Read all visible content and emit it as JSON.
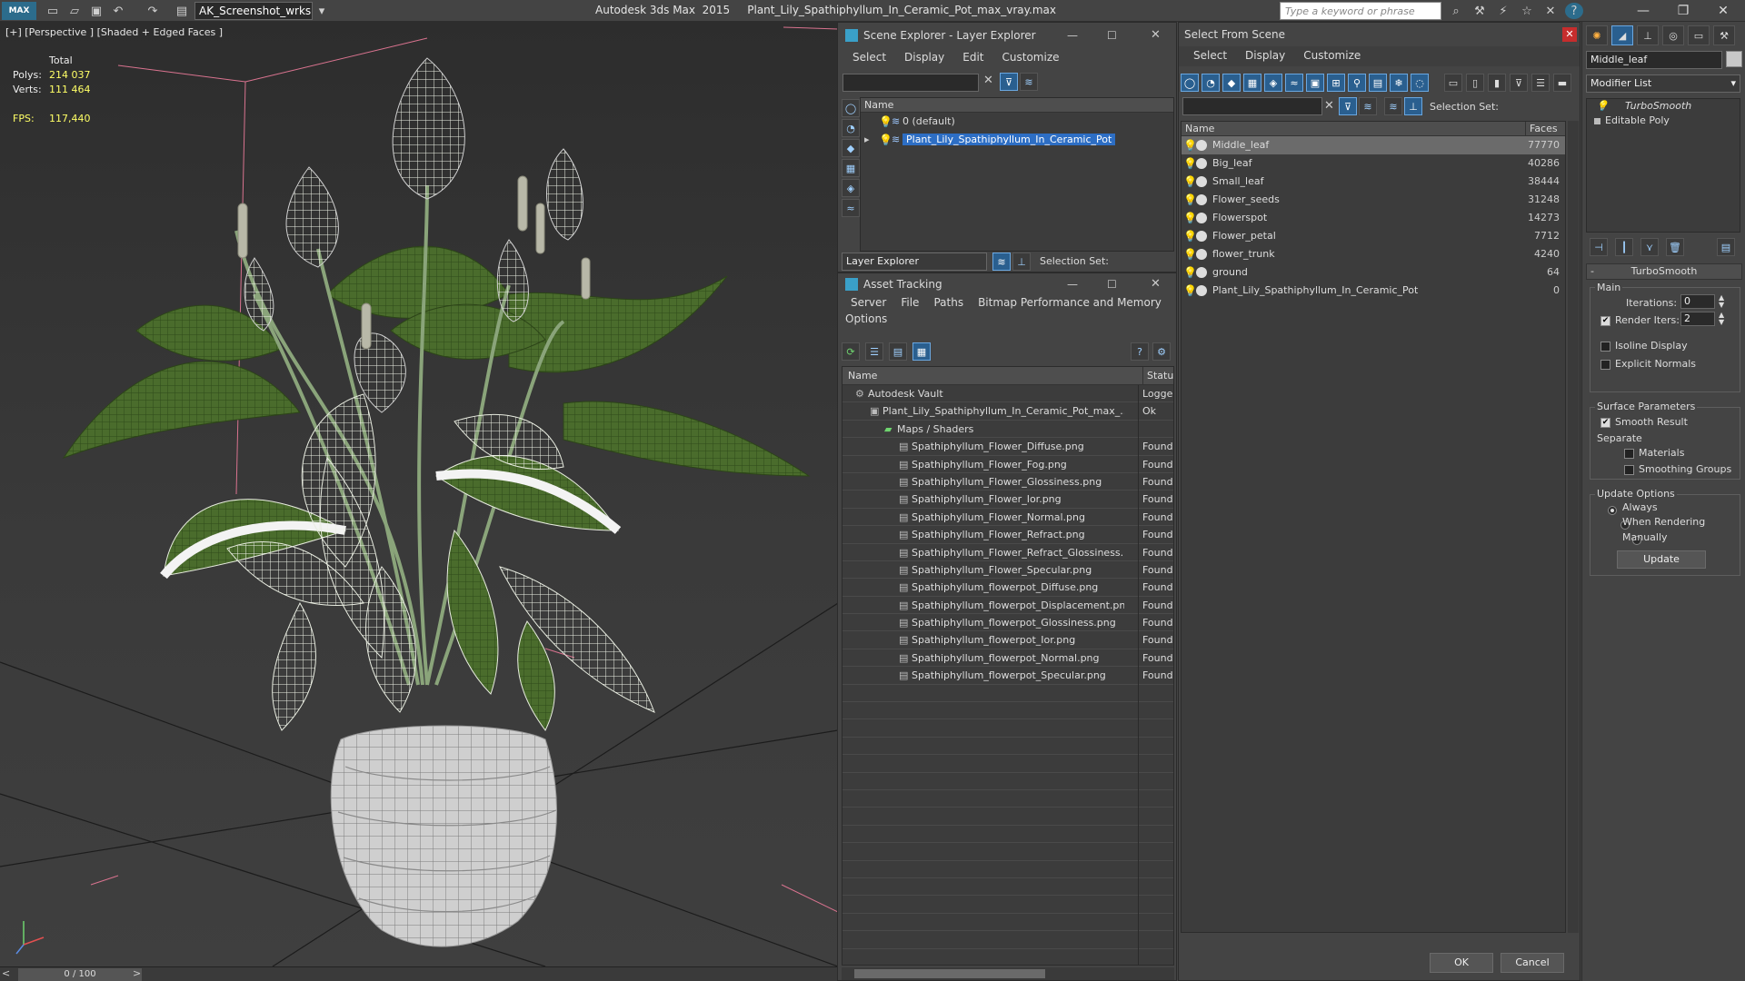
{
  "app": {
    "logo": "MAX",
    "workspace": "AK_Screenshot_wrksp",
    "title": "Autodesk 3ds Max  2015     Plant_Lily_Spathiphyllum_In_Ceramic_Pot_max_vray.max",
    "search_placeholder": "Type a keyword or phrase"
  },
  "viewport": {
    "label": "[+] [Perspective ] [Shaded + Edged Faces ]",
    "stats": {
      "total_label": "Total",
      "polys_label": "Polys:",
      "polys": "214 037",
      "verts_label": "Verts:",
      "verts": "111 464",
      "fps_label": "FPS:",
      "fps": "117,440"
    },
    "frame": "0 / 100"
  },
  "scene_explorer": {
    "title": "Scene Explorer - Layer Explorer",
    "menu": [
      "Select",
      "Display",
      "Edit",
      "Customize"
    ],
    "column": "Name",
    "rows": [
      "0 (default)",
      "Plant_Lily_Spathiphyllum_In_Ceramic_Pot"
    ],
    "footer_dropdown": "Layer Explorer",
    "selection_set": "Selection Set:"
  },
  "asset_tracking": {
    "title": "Asset Tracking",
    "menu": [
      "Server",
      "File",
      "Paths",
      "Bitmap Performance and Memory",
      "Options"
    ],
    "columns": [
      "Name",
      "Status"
    ],
    "rows": [
      {
        "name": "Autodesk Vault",
        "status": "Logge",
        "indent": 0
      },
      {
        "name": "Plant_Lily_Spathiphyllum_In_Ceramic_Pot_max_...",
        "status": "Ok",
        "indent": 1
      },
      {
        "name": "Maps / Shaders",
        "status": "",
        "indent": 2
      },
      {
        "name": "Spathiphyllum_Flower_Diffuse.png",
        "status": "Found",
        "indent": 3
      },
      {
        "name": "Spathiphyllum_Flower_Fog.png",
        "status": "Found",
        "indent": 3
      },
      {
        "name": "Spathiphyllum_Flower_Glossiness.png",
        "status": "Found",
        "indent": 3
      },
      {
        "name": "Spathiphyllum_Flower_Ior.png",
        "status": "Found",
        "indent": 3
      },
      {
        "name": "Spathiphyllum_Flower_Normal.png",
        "status": "Found",
        "indent": 3
      },
      {
        "name": "Spathiphyllum_Flower_Refract.png",
        "status": "Found",
        "indent": 3
      },
      {
        "name": "Spathiphyllum_Flower_Refract_Glossiness....",
        "status": "Found",
        "indent": 3
      },
      {
        "name": "Spathiphyllum_Flower_Specular.png",
        "status": "Found",
        "indent": 3
      },
      {
        "name": "Spathiphyllum_flowerpot_Diffuse.png",
        "status": "Found",
        "indent": 3
      },
      {
        "name": "Spathiphyllum_flowerpot_Displacement.png",
        "status": "Found",
        "indent": 3
      },
      {
        "name": "Spathiphyllum_flowerpot_Glossiness.png",
        "status": "Found",
        "indent": 3
      },
      {
        "name": "Spathiphyllum_flowerpot_Ior.png",
        "status": "Found",
        "indent": 3
      },
      {
        "name": "Spathiphyllum_flowerpot_Normal.png",
        "status": "Found",
        "indent": 3
      },
      {
        "name": "Spathiphyllum_flowerpot_Specular.png",
        "status": "Found",
        "indent": 3
      }
    ]
  },
  "select_from_scene": {
    "title": "Select From Scene",
    "menu": [
      "Select",
      "Display",
      "Customize"
    ],
    "selection_set": "Selection Set:",
    "columns": [
      "Name",
      "Faces"
    ],
    "rows": [
      {
        "name": "Middle_leaf",
        "faces": "77770"
      },
      {
        "name": "Big_leaf",
        "faces": "40286"
      },
      {
        "name": "Small_leaf",
        "faces": "38444"
      },
      {
        "name": "Flower_seeds",
        "faces": "31248"
      },
      {
        "name": "Flowerspot",
        "faces": "14273"
      },
      {
        "name": "Flower_petal",
        "faces": "7712"
      },
      {
        "name": "flower_trunk",
        "faces": "4240"
      },
      {
        "name": "ground",
        "faces": "64"
      },
      {
        "name": "Plant_Lily_Spathiphyllum_In_Ceramic_Pot",
        "faces": "0"
      }
    ],
    "ok": "OK",
    "cancel": "Cancel"
  },
  "command_panel": {
    "object_name": "Middle_leaf",
    "modifier_list": "Modifier List",
    "stack": [
      "TurboSmooth",
      "Editable Poly"
    ],
    "rollout": "TurboSmooth",
    "main_label": "Main",
    "iterations_label": "Iterations:",
    "iterations": "0",
    "render_iters_label": "Render Iters:",
    "render_iters": "2",
    "isoline": "Isoline Display",
    "explicit_normals": "Explicit Normals",
    "surface_params": "Surface Parameters",
    "smooth_result": "Smooth Result",
    "separate": "Separate",
    "materials": "Materials",
    "smoothing_groups": "Smoothing Groups",
    "update_options": "Update Options",
    "always": "Always",
    "when_rendering": "When Rendering",
    "manually": "Manually",
    "update_button": "Update"
  }
}
